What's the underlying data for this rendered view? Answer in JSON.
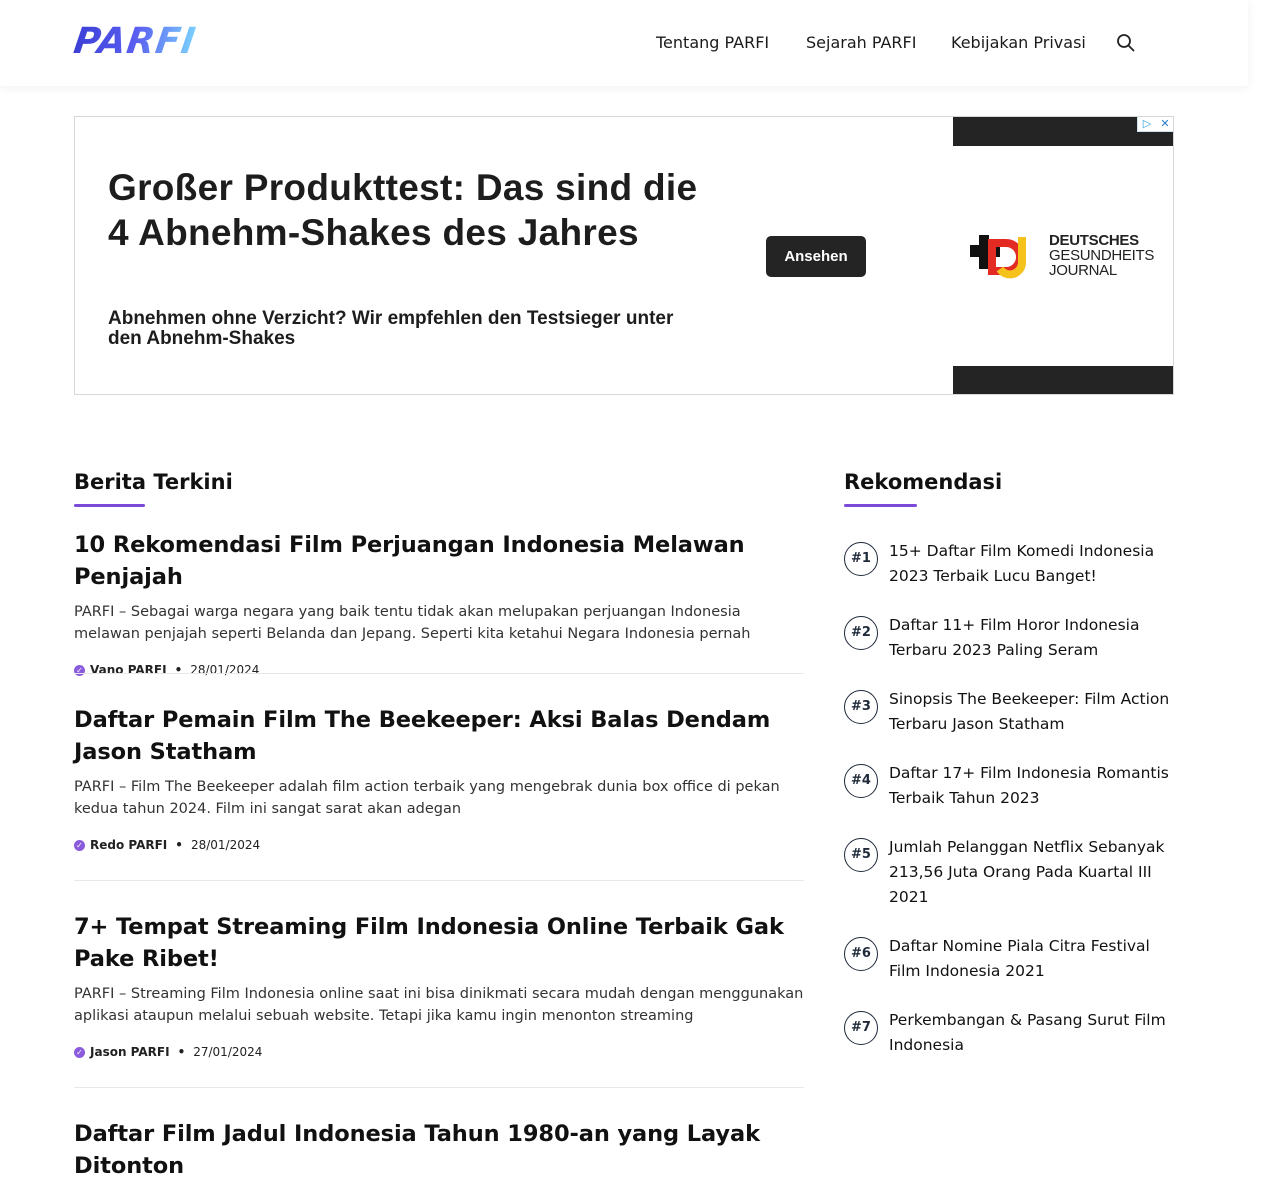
{
  "header": {
    "logo_text": "PARFI",
    "nav": [
      "Tentang PARFI",
      "Sejarah PARFI",
      "Kebijakan Privasi"
    ],
    "search_icon": "search-icon"
  },
  "ad": {
    "title": "Großer Produkttest: Das sind die 4 Abnehm-Shakes des Jahres",
    "subtitle": "Abnehmen ohne Verzicht? Wir empfehlen den Testsieger unter den Abnehm-Shakes",
    "cta": "Ansehen",
    "brand_line1": "DEUTSCHES",
    "brand_line2": "GESUNDHEITS",
    "brand_line3": "JOURNAL",
    "choices_icons": [
      "adchoices-icon",
      "close-icon"
    ]
  },
  "main": {
    "section_title": "Berita Terkini",
    "articles": [
      {
        "title": "10 Rekomendasi Film Perjuangan Indonesia Melawan Penjajah",
        "excerpt": "PARFI – Sebagai warga negara yang baik tentu tidak akan melupakan perjuangan Indonesia melawan penjajah seperti Belanda dan Jepang. Seperti kita ketahui Negara Indonesia pernah",
        "author": "Vano PARFI",
        "date": "28/01/2024"
      },
      {
        "title": "Daftar Pemain Film The Beekeeper: Aksi Balas Dendam Jason Statham",
        "excerpt": "PARFI – Film The Beekeeper adalah film action terbaik yang mengebrak dunia box office di pekan kedua tahun 2024. Film ini sangat sarat akan adegan",
        "author": "Redo PARFI",
        "date": "28/01/2024"
      },
      {
        "title": "7+ Tempat Streaming Film Indonesia Online Terbaik Gak Pake Ribet!",
        "excerpt": "PARFI – Streaming Film Indonesia online saat ini bisa dinikmati secara mudah dengan menggunakan aplikasi ataupun melalui sebuah website. Tetapi jika kamu ingin menonton streaming",
        "author": "Jason PARFI",
        "date": "27/01/2024"
      },
      {
        "title": "Daftar Film Jadul Indonesia Tahun 1980-an yang Layak Ditonton"
      }
    ]
  },
  "sidebar": {
    "section_title": "Rekomendasi",
    "items": [
      {
        "num": "#1",
        "title": "15+ Daftar Film Komedi Indonesia 2023 Terbaik Lucu Banget!"
      },
      {
        "num": "#2",
        "title": "Daftar 11+ Film Horor Indonesia Terbaru 2023 Paling Seram"
      },
      {
        "num": "#3",
        "title": "Sinopsis The Beekeeper: Film Action Terbaru Jason Statham"
      },
      {
        "num": "#4",
        "title": "Daftar 17+ Film Indonesia Romantis Terbaik Tahun 2023"
      },
      {
        "num": "#5",
        "title": "Jumlah Pelanggan Netflix Sebanyak 213,56 Juta Orang Pada Kuartal III 2021"
      },
      {
        "num": "#6",
        "title": "Daftar Nomine Piala Citra Festival Film Indonesia 2021"
      },
      {
        "num": "#7",
        "title": "Perkembangan & Pasang Surut Film Indonesia"
      }
    ]
  }
}
